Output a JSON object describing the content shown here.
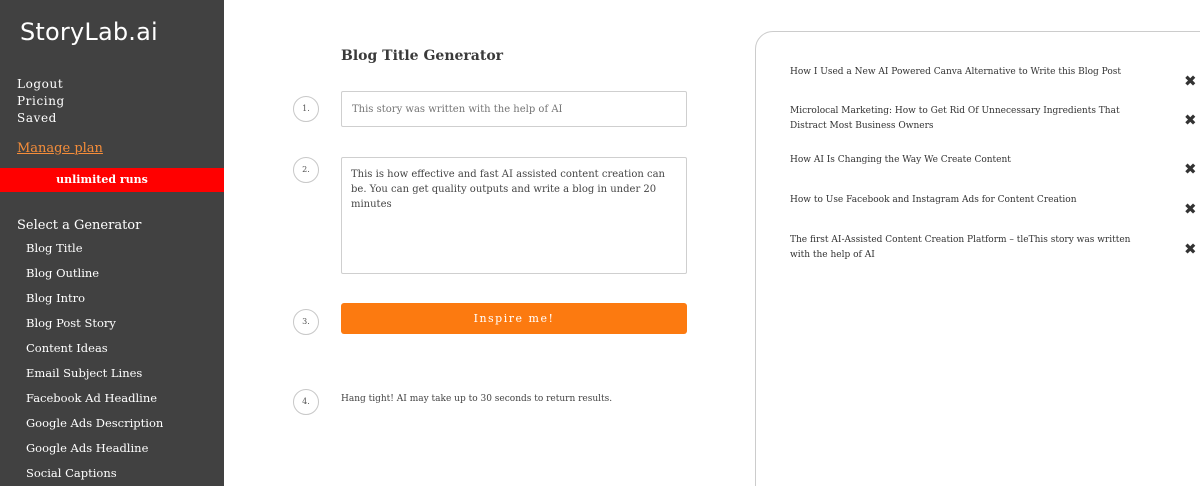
{
  "sidebar": {
    "logo": "StoryLab.ai",
    "account_links": [
      "Logout",
      "Pricing",
      "Saved"
    ],
    "manage_plan": "Manage plan",
    "runs_badge": "unlimited runs",
    "select_title": "Select a Generator",
    "generators": [
      "Blog Title",
      "Blog Outline",
      "Blog Intro",
      "Blog Post Story",
      "Content Ideas",
      "Email Subject Lines",
      "Facebook Ad Headline",
      "Google Ads Description",
      "Google Ads Headline",
      "Social Captions"
    ]
  },
  "main": {
    "title": "Blog Title Generator",
    "steps": [
      "1.",
      "2.",
      "3.",
      "4."
    ],
    "title_input_placeholder": "This story was written with the help of AI",
    "description_value": "This is how effective and fast AI assisted content creation can be. You can get quality outputs and write a blog in under 20 minutes",
    "inspire_label": "Inspire me!",
    "hang_tight": "Hang tight! AI may take up to 30 seconds to return results."
  },
  "results": {
    "items": [
      "How I Used a New AI Powered Canva Alternative to Write this Blog Post",
      "Microlocal Marketing: How to Get Rid Of Unnecessary Ingredients That Distract Most Business Owners",
      "How AI Is Changing the Way We Create Content",
      "How to Use Facebook and Instagram Ads for Content Creation",
      "The first AI-Assisted Content Creation Platform – tleThis story was written with the help of AI"
    ],
    "close_glyph": "✖"
  }
}
